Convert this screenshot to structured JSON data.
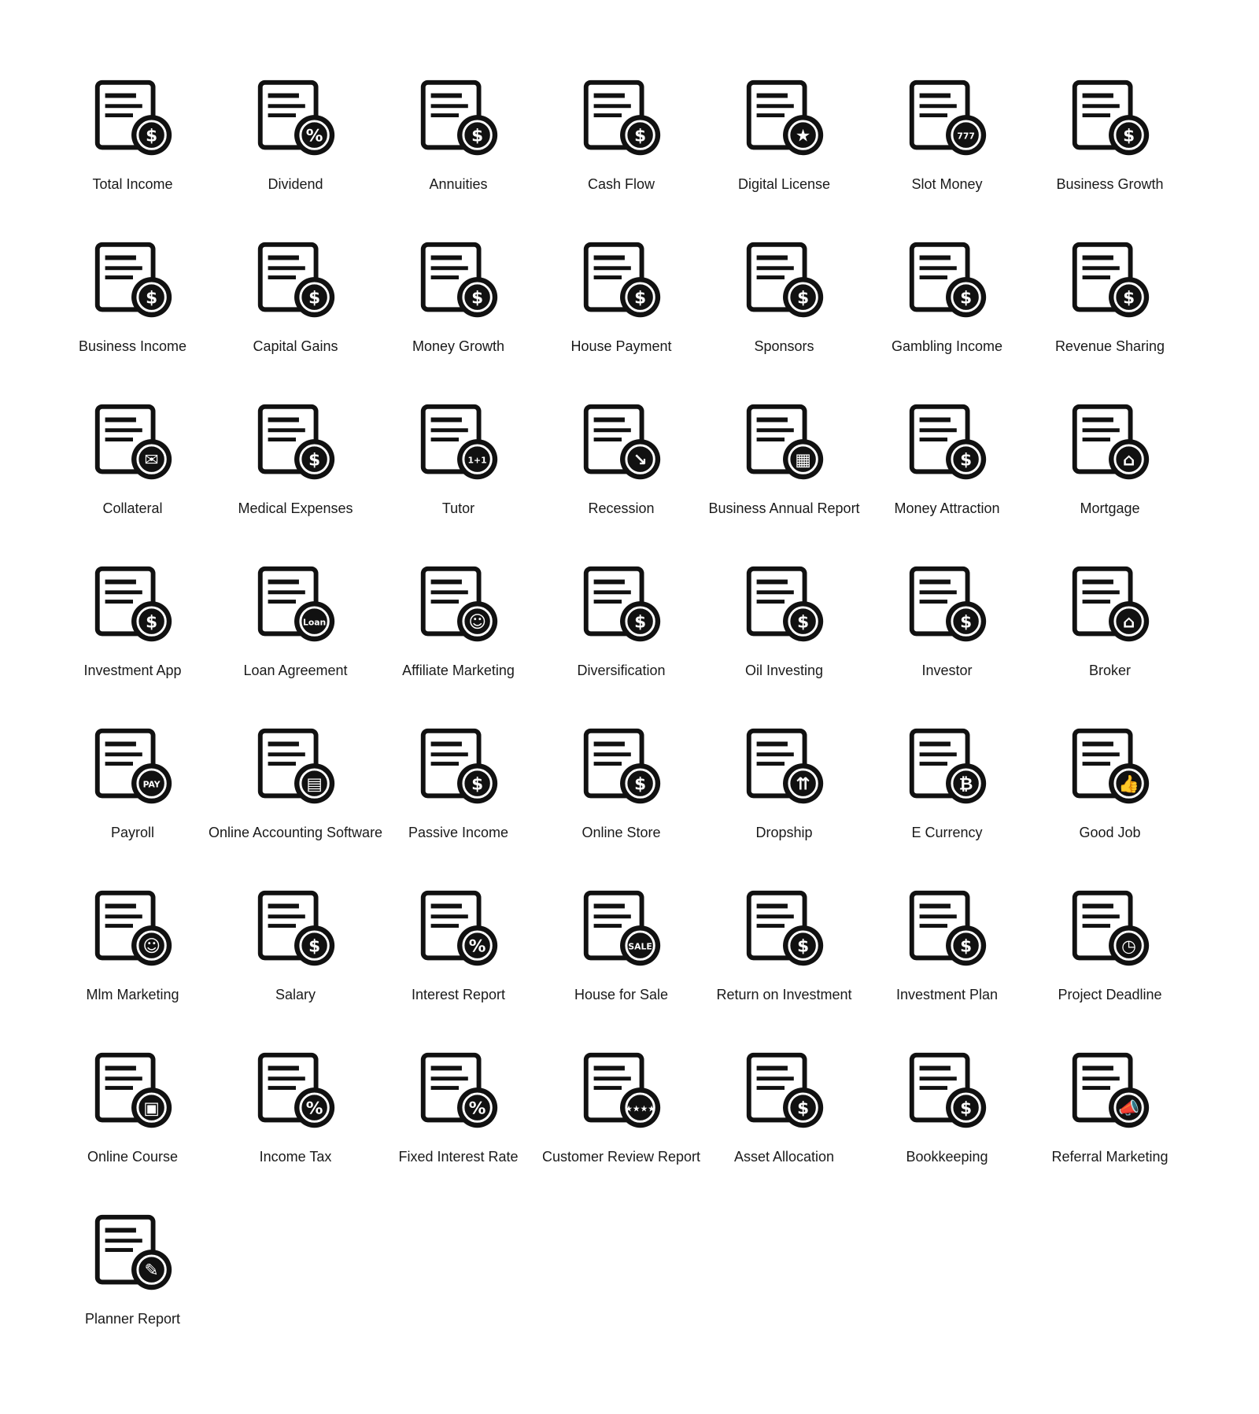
{
  "icon_color": "#111111",
  "items": [
    {
      "label": "Total Income",
      "icon": "money-arrows-icon",
      "glyph": "$"
    },
    {
      "label": "Dividend",
      "icon": "money-bag-pie-icon",
      "glyph": "%"
    },
    {
      "label": "Annuities",
      "icon": "money-bag-clock-icon",
      "glyph": "$"
    },
    {
      "label": "Cash Flow",
      "icon": "banknote-arrows-icon",
      "glyph": "$"
    },
    {
      "label": "Digital License",
      "icon": "monitor-certificate-icon",
      "glyph": "★"
    },
    {
      "label": "Slot Money",
      "icon": "slot-machine-icon",
      "glyph": "777"
    },
    {
      "label": "Business Growth",
      "icon": "growth-chart-coin-icon",
      "glyph": "$"
    },
    {
      "label": "Business Income",
      "icon": "briefcase-coin-icon",
      "glyph": "$"
    },
    {
      "label": "Capital Gains",
      "icon": "hand-coin-arrows-icon",
      "glyph": "$"
    },
    {
      "label": "Money Growth",
      "icon": "plant-coins-icon",
      "glyph": "$"
    },
    {
      "label": "House Payment",
      "icon": "house-coin-icon",
      "glyph": "$"
    },
    {
      "label": "Sponsors",
      "icon": "people-coin-icon",
      "glyph": "$"
    },
    {
      "label": "Gambling Income",
      "icon": "cards-dice-coin-icon",
      "glyph": "$"
    },
    {
      "label": "Revenue Sharing",
      "icon": "money-bag-network-icon",
      "glyph": "$"
    },
    {
      "label": "Collateral",
      "icon": "document-card-envelope-icon",
      "glyph": "✉"
    },
    {
      "label": "Medical Expenses",
      "icon": "clipboard-coin-icon",
      "glyph": "$"
    },
    {
      "label": "Tutor",
      "icon": "teacher-board-icon",
      "glyph": "1+1"
    },
    {
      "label": "Recession",
      "icon": "declining-chart-calculator-icon",
      "glyph": "↘"
    },
    {
      "label": "Business Annual Report",
      "icon": "report-chart-calendar-icon",
      "glyph": "▦"
    },
    {
      "label": "Money Attraction",
      "icon": "magnet-coin-icon",
      "glyph": "$"
    },
    {
      "label": "Mortgage",
      "icon": "hand-house-icon",
      "glyph": "⌂"
    },
    {
      "label": "Investment App",
      "icon": "phone-chart-coin-icon",
      "glyph": "$"
    },
    {
      "label": "Loan Agreement",
      "icon": "loan-document-stamp-icon",
      "glyph": "Loan"
    },
    {
      "label": "Affiliate Marketing",
      "icon": "person-arrows-icon",
      "glyph": "☺"
    },
    {
      "label": "Diversification",
      "icon": "coin-branches-icon",
      "glyph": "$"
    },
    {
      "label": "Oil Investing",
      "icon": "oil-barrel-coin-icon",
      "glyph": "$"
    },
    {
      "label": "Investor",
      "icon": "man-money-bag-icon",
      "glyph": "$"
    },
    {
      "label": "Broker",
      "icon": "man-house-icon",
      "glyph": "⌂"
    },
    {
      "label": "Payroll",
      "icon": "pay-document-coin-icon",
      "glyph": "PAY"
    },
    {
      "label": "Online Accounting Software",
      "icon": "monitor-chart-calculator-icon",
      "glyph": "▤"
    },
    {
      "label": "Passive Income",
      "icon": "hand-cloud-coin-icon",
      "glyph": "$"
    },
    {
      "label": "Online Store",
      "icon": "phone-store-cart-icon",
      "glyph": "$"
    },
    {
      "label": "Dropship",
      "icon": "parachute-box-icon",
      "glyph": "⇈"
    },
    {
      "label": "E Currency",
      "icon": "laptop-bitcoin-icon",
      "glyph": "₿"
    },
    {
      "label": "Good Job",
      "icon": "briefcase-thumbs-up-icon",
      "glyph": "👍"
    },
    {
      "label": "Mlm Marketing",
      "icon": "people-network-icon",
      "glyph": "☺"
    },
    {
      "label": "Salary",
      "icon": "envelope-money-icon",
      "glyph": "$"
    },
    {
      "label": "Interest Report",
      "icon": "percent-report-coin-icon",
      "glyph": "%"
    },
    {
      "label": "House for Sale",
      "icon": "house-sale-sign-icon",
      "glyph": "SALE"
    },
    {
      "label": "Return on Investment",
      "icon": "hand-coin-cycle-icon",
      "glyph": "$"
    },
    {
      "label": "Investment Plan",
      "icon": "report-money-bag-icon",
      "glyph": "$"
    },
    {
      "label": "Project Deadline",
      "icon": "clipboard-clock-icon",
      "glyph": "◷"
    },
    {
      "label": "Online Course",
      "icon": "monitor-book-icon",
      "glyph": "▣"
    },
    {
      "label": "Income Tax",
      "icon": "tax-document-percent-icon",
      "glyph": "%"
    },
    {
      "label": "Fixed Interest Rate",
      "icon": "percent-document-lock-icon",
      "glyph": "%"
    },
    {
      "label": "Customer Review Report",
      "icon": "review-document-thumbs-icon",
      "glyph": "★★★★"
    },
    {
      "label": "Asset Allocation",
      "icon": "coin-allocation-icon",
      "glyph": "$"
    },
    {
      "label": "Bookkeeping",
      "icon": "book-calculator-icon",
      "glyph": "$"
    },
    {
      "label": "Referral Marketing",
      "icon": "phone-megaphone-icon",
      "glyph": "📣"
    },
    {
      "label": "Planner Report",
      "icon": "planner-clock-pencil-icon",
      "glyph": "✎"
    }
  ]
}
